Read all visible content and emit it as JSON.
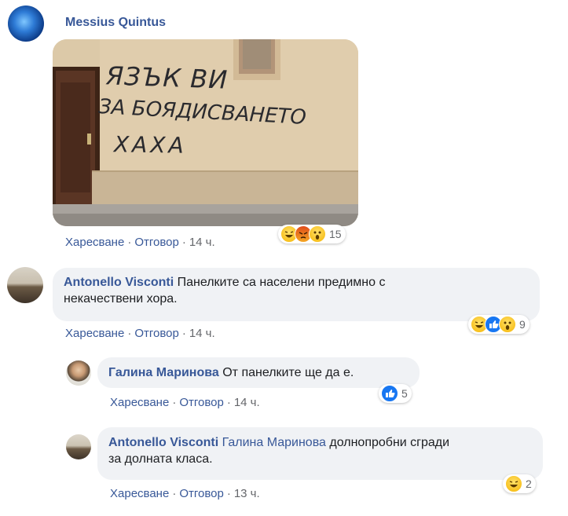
{
  "post": {
    "author": "Messius Quintus",
    "photo_text": [
      "ЯЗЪК ВИ",
      "ЗА БОЯДИСВАНЕТО",
      "ХАХА"
    ],
    "actions": {
      "like": "Харесване",
      "reply": "Отговор",
      "time": "14 ч."
    },
    "reactions": {
      "icons": [
        "haha-icon",
        "angry-icon",
        "wow-icon"
      ],
      "count": "15"
    }
  },
  "comments": [
    {
      "author": "Antonello Visconti",
      "text_line1": "Панелките са населени предимно с",
      "text_line2": "некачествени хора.",
      "actions": {
        "like": "Харесване",
        "reply": "Отговор",
        "time": "14 ч."
      },
      "reactions": {
        "icons": [
          "haha-icon",
          "like-icon",
          "wow-icon"
        ],
        "count": "9"
      }
    },
    {
      "author": "Галина Маринова",
      "text": "От панелките ще да е.",
      "actions": {
        "like": "Харесване",
        "reply": "Отговор",
        "time": "14 ч."
      },
      "reactions": {
        "icons": [
          "like-icon"
        ],
        "count": "5"
      }
    },
    {
      "author": "Antonello Visconti",
      "mention": "Галина Маринова",
      "text_line1": "долнопробни сгради",
      "text_line2": "за долната класа.",
      "actions": {
        "like": "Харесване",
        "reply": "Отговор",
        "time": "13 ч."
      },
      "reactions": {
        "icons": [
          "haha-icon"
        ],
        "count": "2"
      }
    }
  ],
  "colors": {
    "link": "#385898",
    "bubble": "#f0f2f5",
    "meta": "#65676b",
    "like": "#1877f2"
  }
}
